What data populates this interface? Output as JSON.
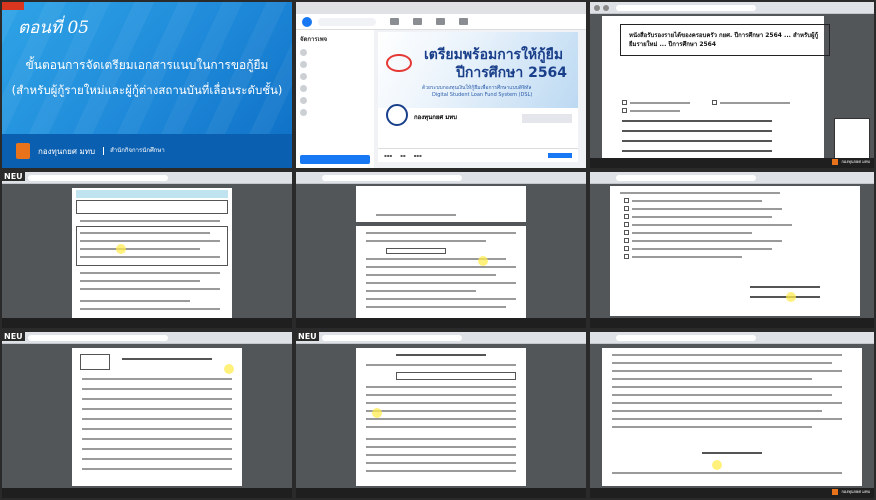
{
  "slide": {
    "episode": "ตอนที่ 05",
    "title_line1": "ขั้นตอนการจัดเตรียมเอกสารแนบในการขอกู้ยืม",
    "title_line2": "(สำหรับผู้กู้รายใหม่และผู้กู้ต่างสถานบันที่เลื่อนระดับชั้น)",
    "footer_org": "กองทุนกยศ มทบ",
    "footer_office": "สำนักกิจการนักศึกษา"
  },
  "facebook": {
    "cover_line1": "เตรียมพร้อมการให้กู้ยืม",
    "cover_line2": "ปีการศึกษา 2564",
    "cover_line3": "ด้วยระบบกองทุนเงินให้กู้ยืมเพื่อการศึกษาแบบดิจิทัล",
    "cover_line4": "Digital Student Loan Fund System (DSL)",
    "page_name": "กองทุนกยศ มทบ",
    "side_header": "จัดการเพจ"
  },
  "doc_title": {
    "text": "หนังสือรับรองรายได้ของครอบครัว กยศ. ปีการศึกษา 2564 ... สำหรับผู้กู้ยืมรายใหม่ ... ปีการศึกษา 2564"
  },
  "labels": {
    "neu": "NEU",
    "watermark": "กองทุนกยศ มทบ"
  }
}
